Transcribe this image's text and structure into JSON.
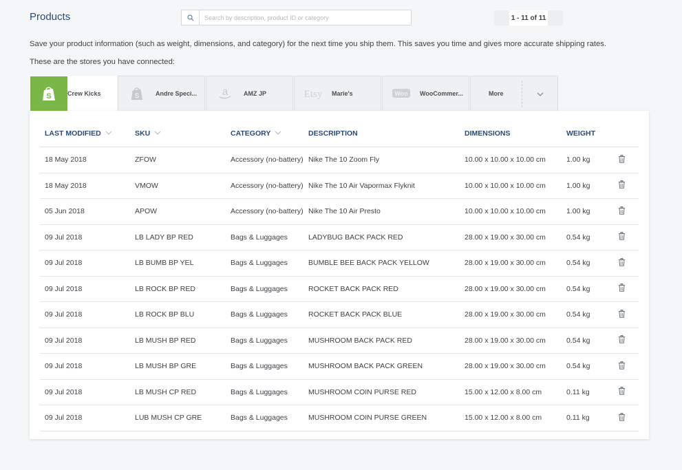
{
  "header": {
    "title": "Products",
    "search_placeholder": "Search by description, product ID or category",
    "pager_text": "1 - 11 of 11"
  },
  "intro_text": "Save your product information (such as weight, dimensions, and category) for the next time you ship them. This saves you time and gives more accurate shipping rates.",
  "stores_label": "These are the stores you have connected:",
  "tabs": [
    {
      "label": "Crew Kicks",
      "icon": "shopify-icon",
      "active": true
    },
    {
      "label": "Andre Speci...",
      "icon": "shopify-icon",
      "active": false
    },
    {
      "label": "AMZ JP",
      "icon": "amazon-icon",
      "active": false
    },
    {
      "label": "Marie's",
      "icon": "etsy-icon",
      "active": false
    },
    {
      "label": "WooCommer...",
      "icon": "woocommerce-icon",
      "active": false
    }
  ],
  "more_tab": {
    "label": "More"
  },
  "table": {
    "columns": [
      "LAST MODIFIED",
      "SKU",
      "CATEGORY",
      "DESCRIPTION",
      "DIMENSIONS",
      "WEIGHT"
    ],
    "rows": [
      {
        "modified": "18 May 2018",
        "sku": "ZFOW",
        "category": "Accessory (no-battery)",
        "description": "Nike The 10 Zoom Fly",
        "dimensions": "10.00 x 10.00 x 10.00 cm",
        "weight": "1.00 kg"
      },
      {
        "modified": "18 May 2018",
        "sku": "VMOW",
        "category": "Accessory (no-battery)",
        "description": "Nike The 10 Air Vapormax Flyknit",
        "dimensions": "10.00 x 10.00 x 10.00 cm",
        "weight": "1.00 kg"
      },
      {
        "modified": "05 Jun 2018",
        "sku": "APOW",
        "category": "Accessory (no-battery)",
        "description": "Nike The 10 Air Presto",
        "dimensions": "10.00 x 10.00 x 10.00 cm",
        "weight": "1.00 kg"
      },
      {
        "modified": "09 Jul 2018",
        "sku": "LB LADY BP RED",
        "category": "Bags & Luggages",
        "description": "LADYBUG BACK PACK RED",
        "dimensions": "28.00 x 19.00 x 30.00 cm",
        "weight": "0.54 kg"
      },
      {
        "modified": "09 Jul 2018",
        "sku": "LB BUMB BP YEL",
        "category": "Bags & Luggages",
        "description": "BUMBLE BEE BACK PACK YELLOW",
        "dimensions": "28.00 x 19.00 x 30.00 cm",
        "weight": "0.54 kg"
      },
      {
        "modified": "09 Jul 2018",
        "sku": "LB ROCK BP RED",
        "category": "Bags & Luggages",
        "description": "ROCKET BACK PACK RED",
        "dimensions": "28.00 x 19.00 x 30.00 cm",
        "weight": "0.54 kg"
      },
      {
        "modified": "09 Jul 2018",
        "sku": "LB ROCK BP BLU",
        "category": "Bags & Luggages",
        "description": "ROCKET BACK PACK BLUE",
        "dimensions": "28.00 x 19.00 x 30.00 cm",
        "weight": "0.54 kg"
      },
      {
        "modified": "09 Jul 2018",
        "sku": "LB MUSH BP RED",
        "category": "Bags & Luggages",
        "description": "MUSHROOM BACK PACK RED",
        "dimensions": "28.00 x 19.00 x 30.00 cm",
        "weight": "0.54 kg"
      },
      {
        "modified": "09 Jul 2018",
        "sku": "LB MUSH BP GRE",
        "category": "Bags & Luggages",
        "description": "MUSHROOM BACK PACK GREEN",
        "dimensions": "28.00 x 19.00 x 30.00 cm",
        "weight": "0.54 kg"
      },
      {
        "modified": "09 Jul 2018",
        "sku": "LB MUSH CP RED",
        "category": "Bags & Luggages",
        "description": "MUSHROOM COIN PURSE RED",
        "dimensions": "15.00 x 12.00 x 8.00 cm",
        "weight": "0.11 kg"
      },
      {
        "modified": "09 Jul 2018",
        "sku": "LUB MUSH CP GRE",
        "category": "Bags & Luggages",
        "description": "MUSHROOM COIN PURSE GREEN",
        "dimensions": "15.00 x 12.00 x 8.00 cm",
        "weight": "0.11 kg"
      }
    ]
  },
  "colors": {
    "accent": "#7ab648",
    "heading": "#2a4a73",
    "text": "#3c4146",
    "background": "#f5f6f7"
  }
}
